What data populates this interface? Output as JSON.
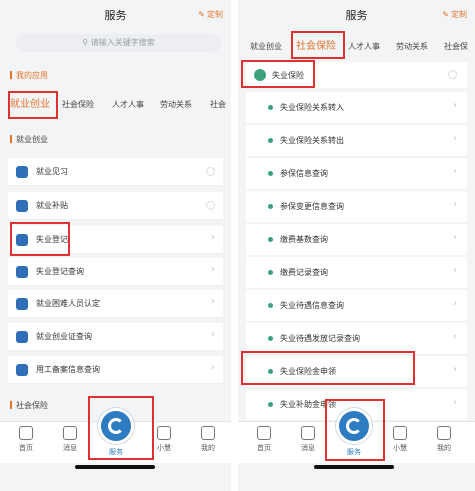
{
  "left": {
    "title": "服务",
    "custom_label": "定制",
    "search_placeholder": "请输入关键字搜索",
    "my_apps_label": "我的应用",
    "tabs": [
      "就业创业",
      "社会保险",
      "人才人事",
      "劳动关系",
      "社会"
    ],
    "section_label": "就业创业",
    "items": [
      "就业见习",
      "就业补贴",
      "失业登记",
      "失业登记查询",
      "就业困难人员认定",
      "就业创业证查询",
      "用工备案信息查询"
    ],
    "next_section_label": "社会保险",
    "nav": [
      "首页",
      "消息",
      "服务",
      "小慧",
      "我的"
    ]
  },
  "right": {
    "title": "服务",
    "custom_label": "定制",
    "tabs": [
      "就业创业",
      "社会保险",
      "人才人事",
      "劳动关系",
      "社会保"
    ],
    "group_label": "失业保险",
    "items": [
      "失业保险关系转入",
      "失业保险关系转出",
      "参保信息查询",
      "参保变更信息查询",
      "缴费基数查询",
      "缴费记录查询",
      "失业待遇信息查询",
      "失业待遇发放记录查询",
      "失业保险金申领",
      "失业补助金申领"
    ],
    "nav": [
      "首页",
      "消息",
      "服务",
      "小慧",
      "我的"
    ]
  },
  "colors": {
    "accent": "#e2742a",
    "highlight": "#e03131",
    "nav_blue": "#2d7cc1",
    "dot_green": "#3ba27c"
  }
}
